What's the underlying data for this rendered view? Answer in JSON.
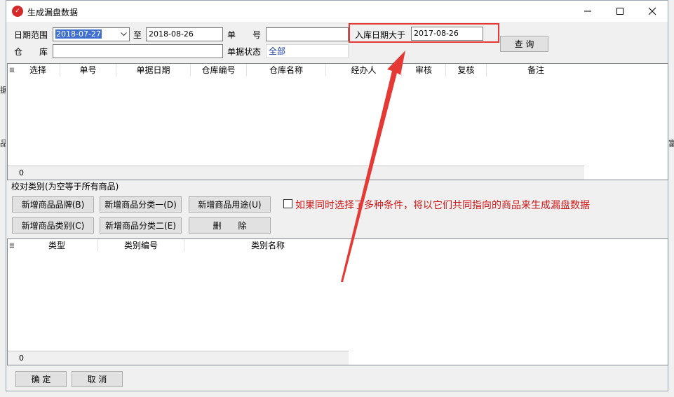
{
  "window": {
    "title": "生成漏盘数据",
    "controls": {
      "minimize": "minimize",
      "maximize": "maximize",
      "close": "close"
    }
  },
  "filters": {
    "date_range_label": "日期范围",
    "date_from": "2018-07-27",
    "to_label": "至",
    "date_to": "2018-08-26",
    "doc_no_label": "单　　号",
    "doc_no_value": "",
    "in_date_label": "入库日期大于",
    "in_date_value": "2017-08-26",
    "query_button": "查 询",
    "warehouse_label": "仓　　库",
    "warehouse_value": "",
    "status_label": "单据状态",
    "status_value": "全部"
  },
  "doc_grid": {
    "columns": [
      "选择",
      "单号",
      "单据日期",
      "仓库编号",
      "仓库名称",
      "经办人",
      "审核",
      "复核",
      "备注"
    ],
    "footer_count": "0"
  },
  "category_section": {
    "title": "校对类别(为空等于所有商品)",
    "buttons": {
      "add_brand": "新增商品品牌(B)",
      "add_class1": "新增商品分类一(D)",
      "add_usage": "新增商品用途(U)",
      "add_category": "新增商品类别(C)",
      "add_class2": "新增商品分类二(E)",
      "delete": "删　　除"
    },
    "notice": "如果同时选择了多种条件，将以它们共同指向的商品来生成漏盘数据"
  },
  "category_grid": {
    "columns": [
      "类型",
      "类别编号",
      "类别名称"
    ],
    "footer_count": "0"
  },
  "actions": {
    "ok": "确 定",
    "cancel": "取 消"
  },
  "background_fragments": {
    "left_1": "据",
    "left_2": "品",
    "right_1": "富"
  },
  "colors": {
    "annotation_red": "#e53935",
    "notice_red": "#d01818",
    "selection_blue": "#3f6fd1"
  }
}
